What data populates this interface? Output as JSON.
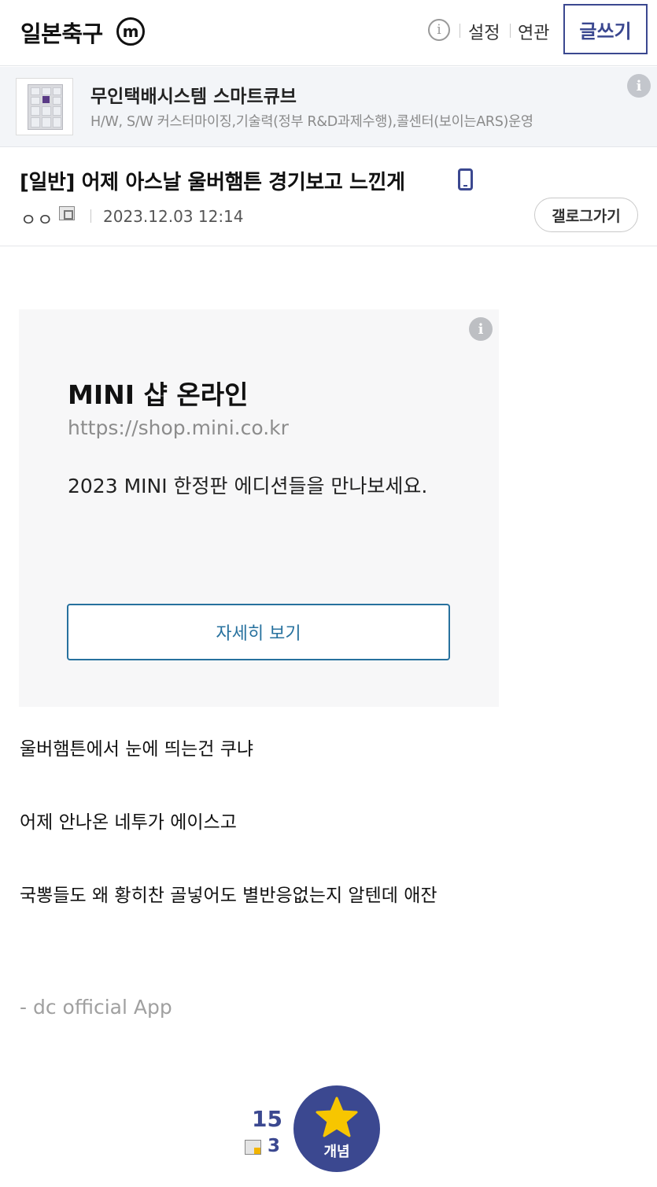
{
  "header": {
    "gallery_title": "일본축구",
    "minor_badge": "m",
    "info_icon": "i",
    "settings_label": "설정",
    "related_label": "연관",
    "write_label": "글쓰기"
  },
  "top_ad": {
    "title": "무인택배시스템 스마트큐브",
    "description": "H/W, S/W 커스터마이징,기술력(정부 R&D과제수행),콜센터(보이는ARS)운영",
    "info_icon": "i"
  },
  "post": {
    "title": "[일반] 어제 아스날 울버햄튼 경기보고 느낀게",
    "author": "ㅇㅇ",
    "date": "2023.12.03 12:14",
    "gallery_button": "갤로그가기"
  },
  "content_ad": {
    "info_icon": "i",
    "title": "MINI 샵 온라인",
    "url": "https://shop.mini.co.kr",
    "description": "2023 MINI 한정판 에디션들을 만나보세요.",
    "button_label": "자세히 보기"
  },
  "body": {
    "lines": [
      "울버햄튼에서 눈에 띄는건 쿠냐",
      "어제 안나온 네투가 에이스고",
      "국뽕들도 왜 황히찬 골넣어도 별반응없는지 알텐데 애잔"
    ],
    "signature": "- dc official App"
  },
  "recommend": {
    "count": "15",
    "mobile_count": "3",
    "button_label": "개념"
  },
  "colors": {
    "brand": "#3b4890",
    "ad_button": "#27719e",
    "divider": "#e4e6ea"
  }
}
